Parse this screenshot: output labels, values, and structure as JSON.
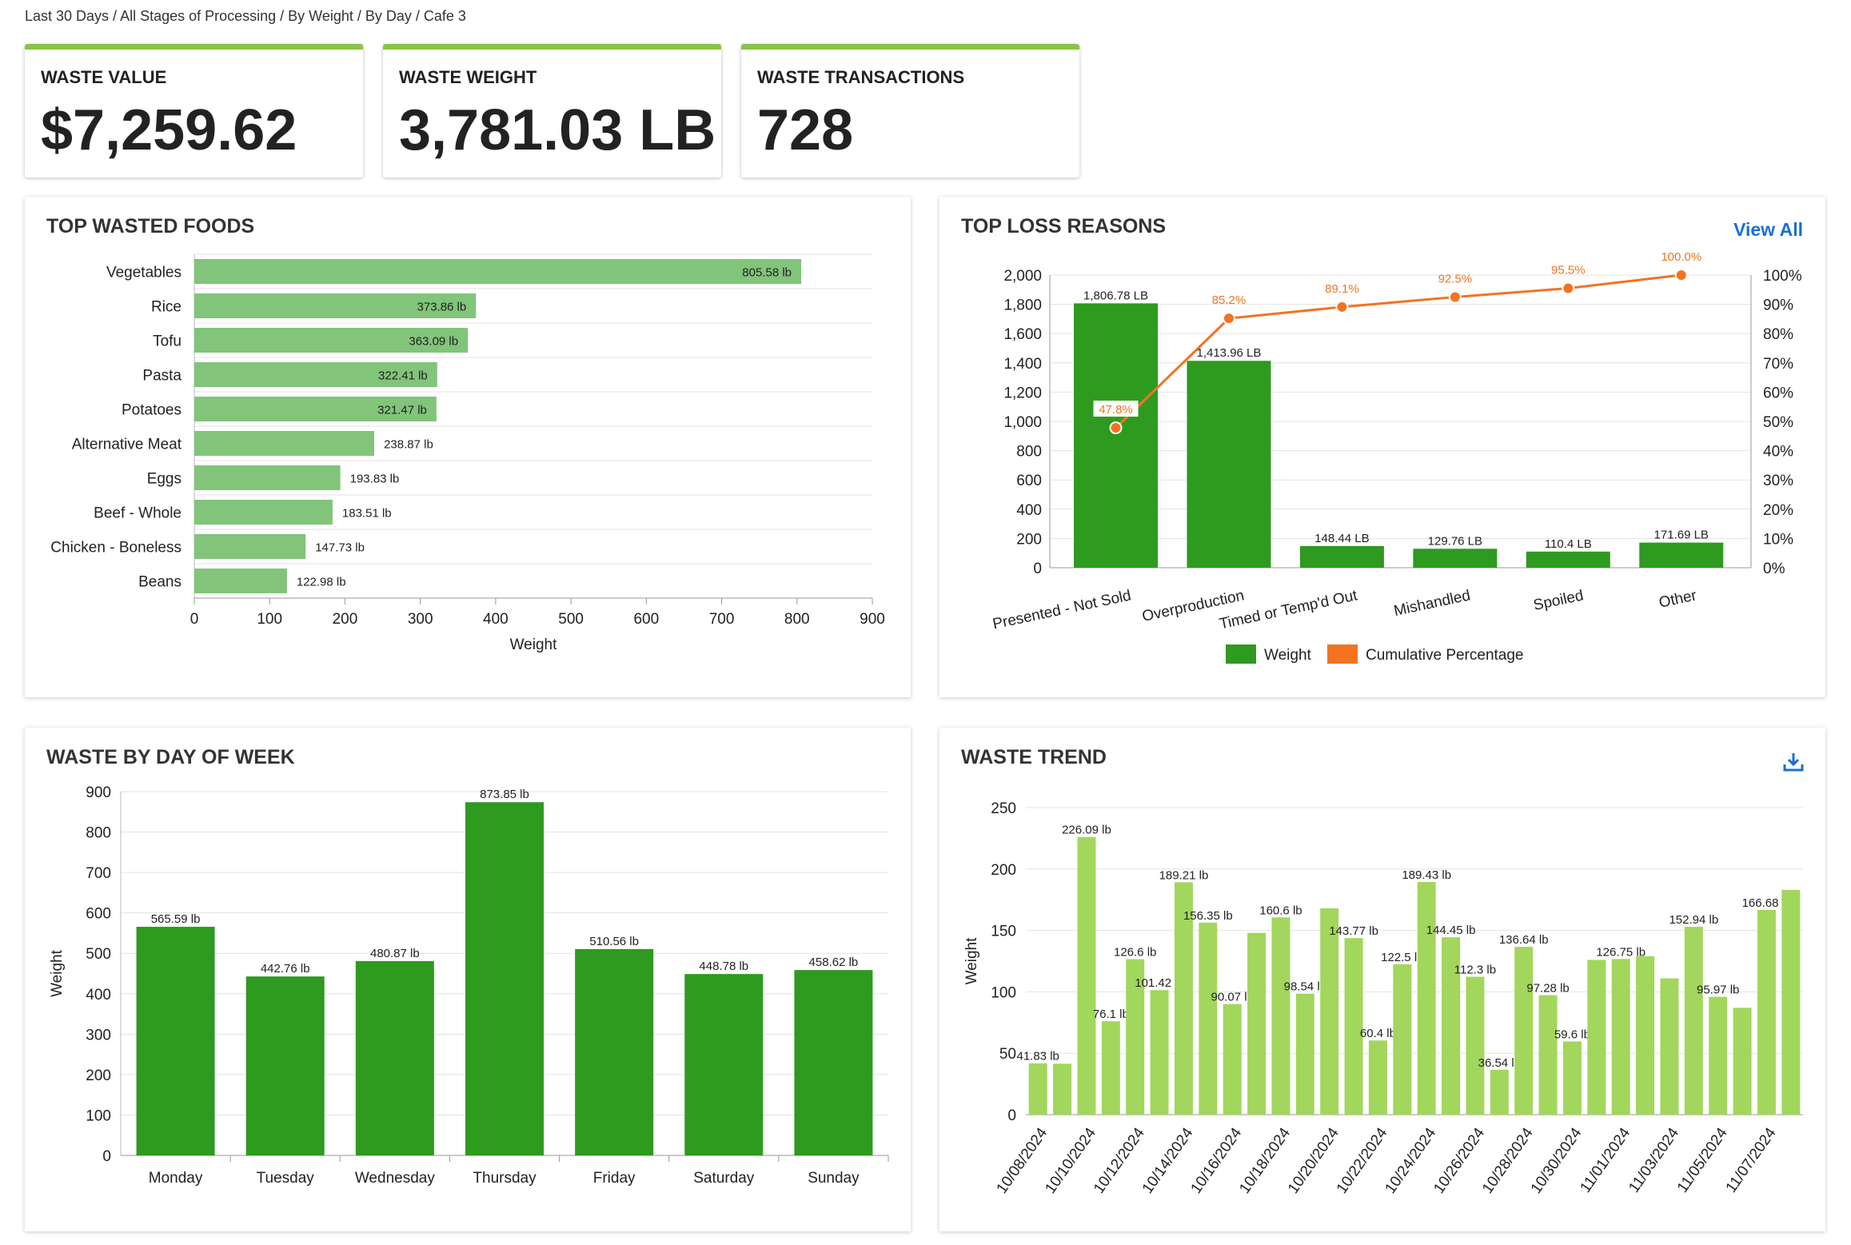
{
  "breadcrumb": "Last 30 Days / All Stages of Processing / By Weight / By Day / Cafe 3",
  "kpis": [
    {
      "label": "WASTE VALUE",
      "value": "$7,259.62"
    },
    {
      "label": "WASTE WEIGHT",
      "value": "3,781.03 LB"
    },
    {
      "label": "WASTE TRANSACTIONS",
      "value": "728"
    }
  ],
  "colors": {
    "kpi_accent": "#8bc34a",
    "light_green": "#81c47a",
    "dark_green": "#2e9a1f",
    "trend_green": "#a3d65c",
    "orange": "#f37321",
    "link": "#1a6fd1"
  },
  "panels": {
    "top_wasted": {
      "title": "TOP WASTED FOODS"
    },
    "loss_reasons": {
      "title": "TOP LOSS REASONS",
      "link": "View All"
    },
    "by_day": {
      "title": "WASTE BY DAY OF WEEK"
    },
    "trend": {
      "title": "WASTE TREND",
      "icon": "download-icon"
    }
  },
  "chart_data": [
    {
      "type": "bar",
      "orientation": "horizontal",
      "categories": [
        "Vegetables",
        "Rice",
        "Tofu",
        "Pasta",
        "Potatoes",
        "Alternative Meat",
        "Eggs",
        "Beef - Whole",
        "Chicken - Boneless",
        "Beans"
      ],
      "values": [
        805.58,
        373.86,
        363.09,
        322.41,
        321.47,
        238.87,
        193.83,
        183.51,
        147.73,
        122.98
      ],
      "labels": [
        "805.58 lb",
        "373.86 lb",
        "363.09 lb",
        "322.41 lb",
        "321.47 lb",
        "238.87 lb",
        "193.83 lb",
        "183.51 lb",
        "147.73 lb",
        "122.98 lb"
      ],
      "xlabel": "Weight",
      "xlim": [
        0,
        900
      ],
      "ticks": [
        "0",
        "100",
        "200",
        "300",
        "400",
        "500",
        "600",
        "700",
        "800",
        "900"
      ],
      "grid": true
    },
    {
      "type": "bar",
      "categories": [
        "Presented - Not Sold",
        "Overproduction",
        "Timed or Temp'd Out",
        "Mishandled",
        "Spoiled",
        "Other"
      ],
      "series": [
        {
          "name": "Weight",
          "values": [
            1806.78,
            1413.96,
            148.44,
            129.76,
            110.4,
            171.69
          ],
          "labels": [
            "1,806.78 LB",
            "1,413.96 LB",
            "148.44 LB",
            "129.76 LB",
            "110.4 LB",
            "171.69 LB"
          ]
        },
        {
          "name": "Cumulative Percentage",
          "type": "line",
          "values": [
            47.8,
            85.2,
            89.1,
            92.5,
            95.5,
            100.0
          ],
          "labels": [
            "47.8%",
            "85.2%",
            "89.1%",
            "92.5%",
            "95.5%",
            "100.0%"
          ]
        }
      ],
      "ylim": [
        0,
        2000
      ],
      "y2lim": [
        0,
        100
      ],
      "yticks": [
        "0",
        "200",
        "400",
        "600",
        "800",
        "1,000",
        "1,200",
        "1,400",
        "1,600",
        "1,800",
        "2,000"
      ],
      "y2ticks": [
        "0%",
        "10%",
        "20%",
        "30%",
        "40%",
        "50%",
        "60%",
        "70%",
        "80%",
        "90%",
        "100%"
      ],
      "legend": "bottom",
      "grid": true
    },
    {
      "type": "bar",
      "categories": [
        "Monday",
        "Tuesday",
        "Wednesday",
        "Thursday",
        "Friday",
        "Saturday",
        "Sunday"
      ],
      "values": [
        565.59,
        442.76,
        480.87,
        873.85,
        510.56,
        448.78,
        458.62
      ],
      "labels": [
        "565.59 lb",
        "442.76 lb",
        "480.87 lb",
        "873.85 lb",
        "510.56 lb",
        "448.78 lb",
        "458.62 lb"
      ],
      "ylabel": "Weight",
      "ylim": [
        0,
        900
      ],
      "yticks": [
        "0",
        "100",
        "200",
        "300",
        "400",
        "500",
        "600",
        "700",
        "800",
        "900"
      ],
      "grid": true
    },
    {
      "type": "bar",
      "x": [
        "10/08/2024",
        "10/09/2024",
        "10/10/2024",
        "10/11/2024",
        "10/12/2024",
        "10/13/2024",
        "10/14/2024",
        "10/15/2024",
        "10/16/2024",
        "10/17/2024",
        "10/18/2024",
        "10/19/2024",
        "10/20/2024",
        "10/21/2024",
        "10/22/2024",
        "10/23/2024",
        "10/24/2024",
        "10/25/2024",
        "10/26/2024",
        "10/27/2024",
        "10/28/2024",
        "10/29/2024",
        "10/30/2024",
        "10/31/2024",
        "11/01/2024",
        "11/02/2024",
        "11/03/2024",
        "11/04/2024",
        "11/05/2024",
        "11/06/2024",
        "11/07/2024",
        "11/08/2024"
      ],
      "values": [
        41.83,
        41.5,
        226.09,
        76.1,
        126.6,
        101.42,
        189.21,
        156.35,
        90.07,
        148.0,
        160.6,
        98.54,
        168.0,
        143.77,
        60.4,
        122.5,
        189.43,
        144.45,
        112.3,
        36.54,
        136.64,
        97.28,
        59.6,
        126.0,
        126.75,
        129.0,
        111.0,
        152.94,
        95.97,
        87.0,
        166.68,
        183.0
      ],
      "labels": [
        "41.83 lb",
        "",
        "226.09 lb",
        "76.1 lb",
        "126.6 lb",
        "101.42 lb",
        "189.21 lb",
        "156.35 lb",
        "90.07 lb",
        "",
        "160.6 lb",
        "98.54 lb",
        "",
        "143.77 lb",
        "60.4 lb",
        "122.5 lb",
        "189.43 lb",
        "144.45 lb",
        "112.3 lb",
        "36.54 lb",
        "136.64 lb",
        "97.28 lb",
        "59.6 lb",
        "",
        "126.75 lb",
        "",
        "",
        "152.94 lb",
        "95.97 lb",
        "",
        "166.68 lb",
        ""
      ],
      "tick_labels": [
        "10/08/2024",
        "10/10/2024",
        "10/12/2024",
        "10/14/2024",
        "10/16/2024",
        "10/18/2024",
        "10/20/2024",
        "10/22/2024",
        "10/24/2024",
        "10/26/2024",
        "10/28/2024",
        "10/30/2024",
        "11/01/2024",
        "11/03/2024",
        "11/05/2024",
        "11/07/2024"
      ],
      "ylabel": "Weight",
      "ylim": [
        0,
        250
      ],
      "yticks": [
        "0",
        "50",
        "100",
        "150",
        "200",
        "250"
      ],
      "grid": true
    }
  ]
}
